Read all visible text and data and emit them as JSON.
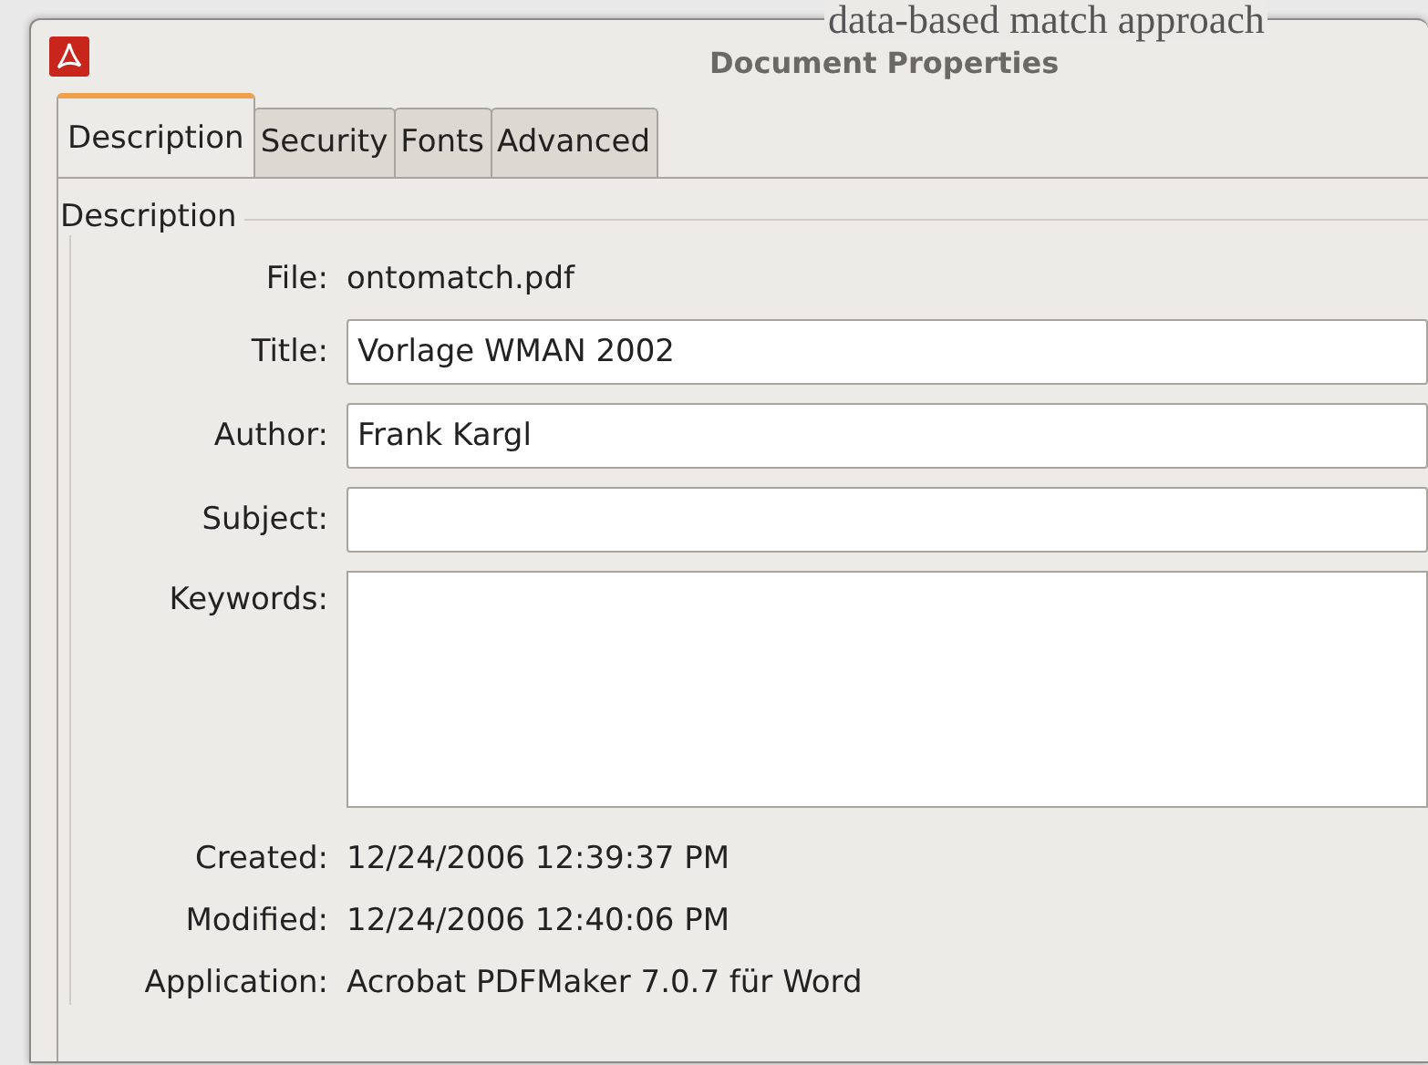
{
  "background_text": [
    "data-based match approach"
  ],
  "window": {
    "title": "Document Properties"
  },
  "tabs": [
    {
      "label": "Description",
      "selected": true
    },
    {
      "label": "Security",
      "selected": false
    },
    {
      "label": "Fonts",
      "selected": false
    },
    {
      "label": "Advanced",
      "selected": false
    }
  ],
  "section": {
    "legend": "Description",
    "fields": [
      {
        "kind": "text",
        "label": "File:",
        "value": "ontomatch.pdf"
      },
      {
        "kind": "input",
        "label": "Title:",
        "value": "Vorlage WMAN 2002"
      },
      {
        "kind": "input",
        "label": "Author:",
        "value": "Frank Kargl"
      },
      {
        "kind": "input",
        "label": "Subject:"
      },
      {
        "kind": "textarea",
        "label": "Keywords:"
      },
      {
        "kind": "text",
        "label": "Created:",
        "value": "12/24/2006 12:39:37 PM"
      },
      {
        "kind": "text",
        "label": "Modified:",
        "value": "12/24/2006 12:40:06 PM"
      },
      {
        "kind": "text",
        "label": "Application:",
        "value": "Acrobat PDFMaker 7.0.7 für Word"
      }
    ]
  }
}
